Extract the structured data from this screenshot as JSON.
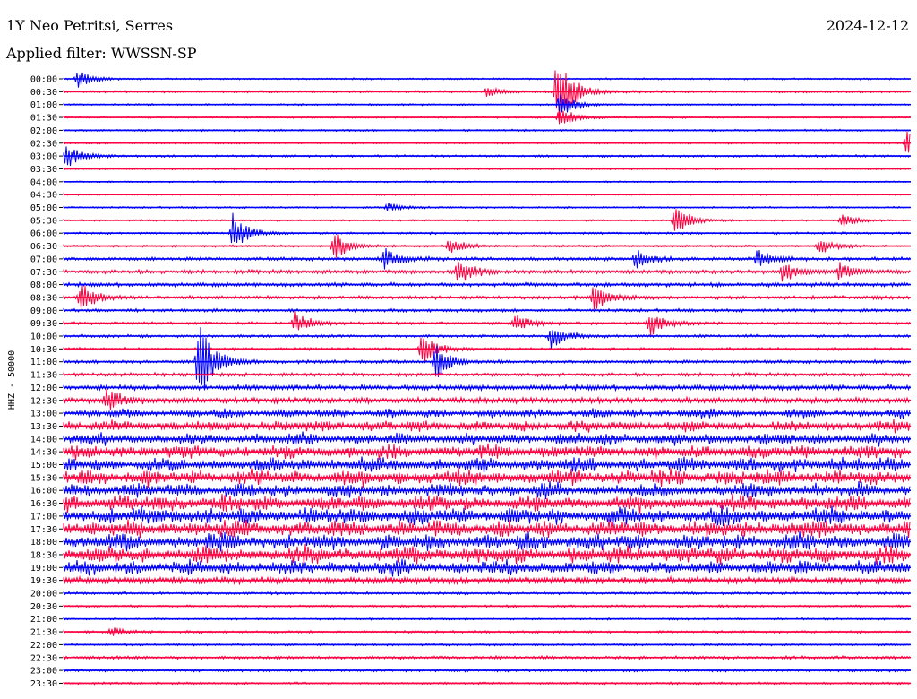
{
  "header": {
    "station": "1Y Neo Petritsi, Serres",
    "date": "2024-12-12",
    "filter": "Applied filter: WWSSN-SP"
  },
  "chart_data": {
    "type": "line",
    "title": "1Y Neo Petritsi, Serres",
    "ylabel": "HHZ - 50000",
    "row_labels": [
      "00:00",
      "00:30",
      "01:00",
      "01:30",
      "02:00",
      "02:30",
      "03:00",
      "03:30",
      "04:00",
      "04:30",
      "05:00",
      "05:30",
      "06:00",
      "06:30",
      "07:00",
      "07:30",
      "08:00",
      "08:30",
      "09:00",
      "09:30",
      "10:00",
      "10:30",
      "11:00",
      "11:30",
      "12:00",
      "12:30",
      "13:00",
      "13:30",
      "14:00",
      "14:30",
      "15:00",
      "15:30",
      "16:00",
      "16:30",
      "17:00",
      "17:30",
      "18:00",
      "18:30",
      "19:00",
      "19:30",
      "20:00",
      "20:30",
      "21:00",
      "21:30",
      "22:00",
      "22:30",
      "23:00",
      "23:30"
    ],
    "row_colors": [
      "#0000ff",
      "#ff0040"
    ],
    "row_noise": [
      0.8,
      1,
      0.8,
      0.8,
      0.9,
      0.8,
      1,
      0.8,
      0.7,
      0.7,
      0.8,
      0.8,
      1,
      1,
      1.6,
      1.8,
      1.8,
      1.6,
      1.4,
      1.3,
      1.3,
      1.3,
      1.5,
      1.6,
      2.4,
      2.6,
      3.5,
      4.5,
      5,
      5.5,
      6,
      6.5,
      6,
      6.5,
      7,
      7,
      7,
      7,
      6,
      3,
      1.2,
      1,
      0.9,
      1,
      1,
      1.4,
      1.2,
      1
    ],
    "events": [
      {
        "row": 0,
        "time_min": 0.5,
        "amplitude": 10
      },
      {
        "row": 1,
        "time_min": 15,
        "amplitude": 5
      },
      {
        "row": 1,
        "time_min": 17.5,
        "amplitude": 50
      },
      {
        "row": 2,
        "time_min": 17.6,
        "amplitude": 14
      },
      {
        "row": 3,
        "time_min": 17.6,
        "amplitude": 12
      },
      {
        "row": 6,
        "time_min": 0.1,
        "amplitude": 14
      },
      {
        "row": 5,
        "time_min": 29.9,
        "amplitude": 14
      },
      {
        "row": 10,
        "time_min": 11.5,
        "amplitude": 5
      },
      {
        "row": 11,
        "time_min": 21.7,
        "amplitude": 18
      },
      {
        "row": 11,
        "time_min": 27.6,
        "amplitude": 8
      },
      {
        "row": 12,
        "time_min": 6,
        "amplitude": 22
      },
      {
        "row": 13,
        "time_min": 9.6,
        "amplitude": 16
      },
      {
        "row": 13,
        "time_min": 13.7,
        "amplitude": 10
      },
      {
        "row": 13,
        "time_min": 26.8,
        "amplitude": 10
      },
      {
        "row": 14,
        "time_min": 11.4,
        "amplitude": 12
      },
      {
        "row": 14,
        "time_min": 20.3,
        "amplitude": 10
      },
      {
        "row": 14,
        "time_min": 24.6,
        "amplitude": 10
      },
      {
        "row": 15,
        "time_min": 14,
        "amplitude": 14
      },
      {
        "row": 15,
        "time_min": 25.5,
        "amplitude": 12
      },
      {
        "row": 15,
        "time_min": 27.5,
        "amplitude": 10
      },
      {
        "row": 17,
        "time_min": 0.6,
        "amplitude": 16
      },
      {
        "row": 17,
        "time_min": 18.8,
        "amplitude": 16
      },
      {
        "row": 19,
        "time_min": 8.2,
        "amplitude": 14
      },
      {
        "row": 19,
        "time_min": 16,
        "amplitude": 10
      },
      {
        "row": 19,
        "time_min": 20.8,
        "amplitude": 14
      },
      {
        "row": 20,
        "time_min": 17.3,
        "amplitude": 14
      },
      {
        "row": 21,
        "time_min": 12.7,
        "amplitude": 18
      },
      {
        "row": 22,
        "time_min": 13.2,
        "amplitude": 20
      },
      {
        "row": 22,
        "time_min": 4.8,
        "amplitude": 50
      },
      {
        "row": 25,
        "time_min": 1.5,
        "amplitude": 14
      },
      {
        "row": 43,
        "time_min": 1.7,
        "amplitude": 5
      }
    ]
  }
}
